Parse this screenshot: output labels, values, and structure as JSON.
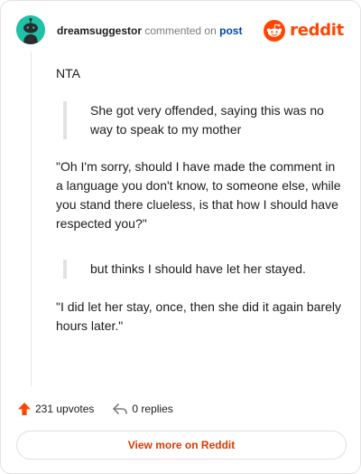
{
  "header": {
    "username": "dreamsuggestor",
    "action_text": "commented on",
    "post_link": "post",
    "logo_text": "reddit",
    "avatar_icon": "snoo-avatar-icon",
    "logo_icon": "reddit-snoo-icon"
  },
  "comment": {
    "paragraphs": [
      {
        "type": "text",
        "text": "NTA"
      },
      {
        "type": "quote",
        "text": "She got very offended, saying this was no way to speak to my mother"
      },
      {
        "type": "text",
        "text": "\"Oh I'm sorry, should I have made the comment in a language you don't know, to someone else, while you stand there clueless, is that how I should have respected you?\""
      },
      {
        "type": "quote",
        "text": "but thinks I should have let her stayed."
      },
      {
        "type": "text",
        "text": "\"I did let her stay, once, then she did it again barely hours later.\""
      }
    ]
  },
  "footer": {
    "upvotes": "231 upvotes",
    "replies": "0 replies",
    "upvote_icon": "upvote-arrow-icon",
    "reply_icon": "reply-arrow-icon"
  },
  "cta": {
    "view_more": "View more on Reddit"
  },
  "colors": {
    "brand": "#ff4500",
    "link": "#0045ac",
    "cta": "#d93a00",
    "avatar": "#21c0a8"
  }
}
